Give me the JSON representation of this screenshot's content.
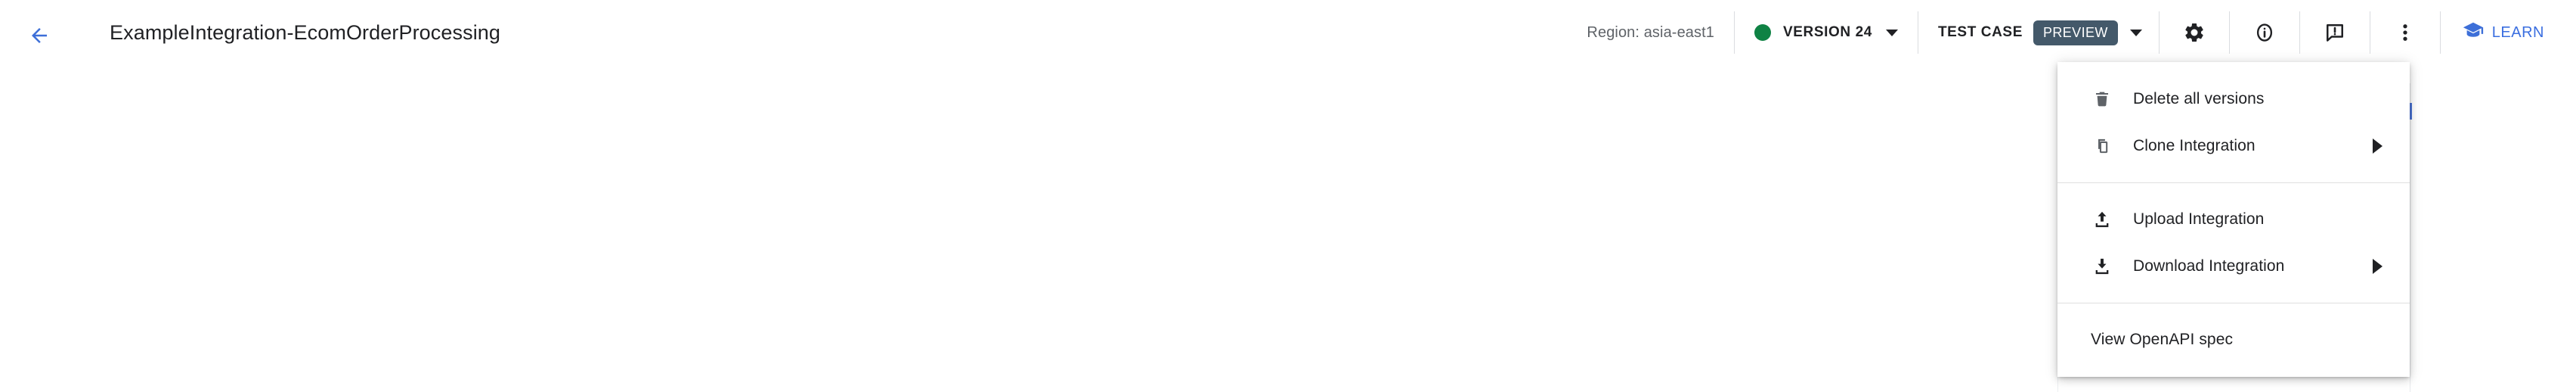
{
  "header": {
    "back_icon": "arrow-left-icon",
    "title": "ExampleIntegration-EcomOrderProcessing",
    "region_label": "Region: asia-east1",
    "version": {
      "status_dot_color": "#0f8244",
      "label": "VERSION 24",
      "caret_icon": "chevron-down-icon"
    },
    "test_case": {
      "label": "TEST CASE",
      "badge": "PREVIEW",
      "badge_color": "#44596a",
      "caret_icon": "chevron-down-icon"
    },
    "icons": [
      {
        "name": "settings-gear-icon"
      },
      {
        "name": "info-circle-icon"
      },
      {
        "name": "feedback-icon"
      },
      {
        "name": "more-vert-icon"
      }
    ],
    "learn": {
      "icon": "graduation-cap-icon",
      "label": "LEARN",
      "color": "#3b6fe0"
    }
  },
  "dropdown_menu": {
    "groups": [
      {
        "items": [
          {
            "icon": "trash-icon",
            "label": "Delete all versions",
            "has_submenu": false
          },
          {
            "icon": "copy-icon",
            "label": "Clone Integration",
            "has_submenu": true
          }
        ]
      },
      {
        "items": [
          {
            "icon": "upload-icon",
            "label": "Upload Integration",
            "has_submenu": false
          },
          {
            "icon": "download-icon",
            "label": "Download Integration",
            "has_submenu": true
          }
        ]
      },
      {
        "items": [
          {
            "icon": null,
            "label": "View OpenAPI spec",
            "has_submenu": false
          }
        ]
      }
    ]
  }
}
